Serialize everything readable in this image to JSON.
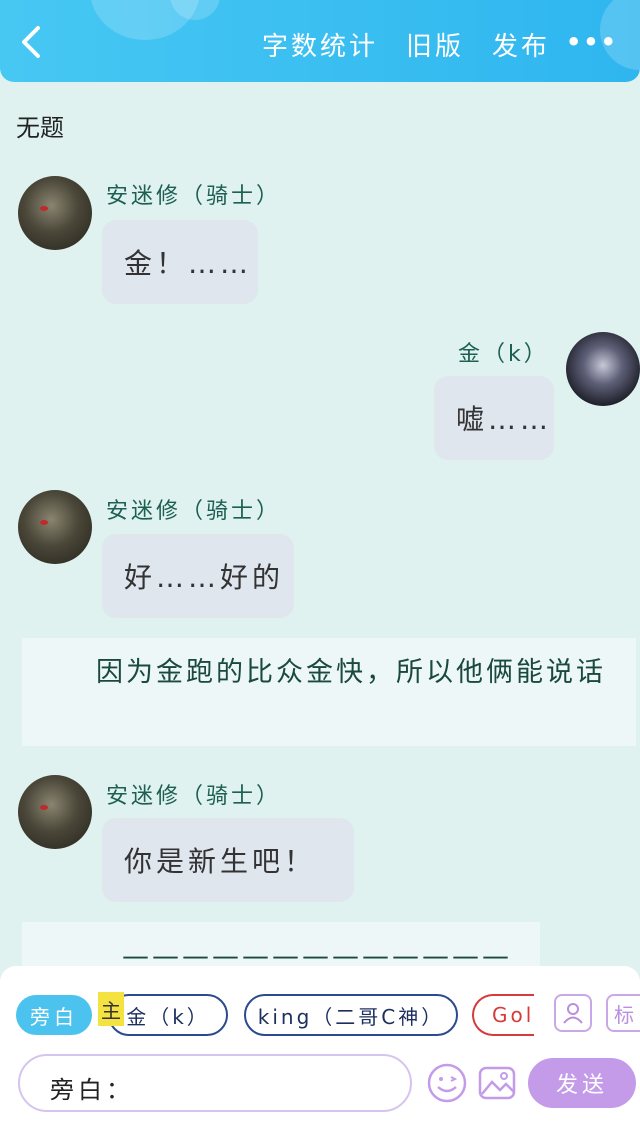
{
  "header": {
    "actions": [
      "字数统计",
      "旧版",
      "发布"
    ],
    "more": "•••",
    "colors": {
      "bar": "#2fb6ef",
      "bar_light": "#47c8f3"
    }
  },
  "page_title": "无题",
  "messages": [
    {
      "speaker": "安迷修（骑士）",
      "text": "金！……",
      "side": "left"
    },
    {
      "speaker": "金（k）",
      "text": "嘘……",
      "side": "right"
    },
    {
      "speaker": "安迷修（骑士）",
      "text": "好……好的",
      "side": "left"
    },
    {
      "narration": "　　因为金跑的比众金快，所以他俩能说话"
    },
    {
      "speaker": "安迷修（骑士）",
      "text": "你是新生吧！",
      "side": "left"
    },
    {
      "narration": "—————————————"
    }
  ],
  "composer": {
    "narration_chip": "旁白",
    "main_tag": "主",
    "character_chips": [
      "金（k）",
      "king（二哥C神）",
      "Gold"
    ],
    "tag_icon_text": "标",
    "input_label": "旁白：",
    "send_label": "发送",
    "icons": [
      "person-card-icon",
      "tag-icon",
      "emoji-icon",
      "image-icon"
    ],
    "colors": {
      "narration_chip": "#4cc3ee",
      "send": "#c49be8",
      "chip_border": "#2c4b8c",
      "chip_red": "#d63b3b"
    }
  }
}
